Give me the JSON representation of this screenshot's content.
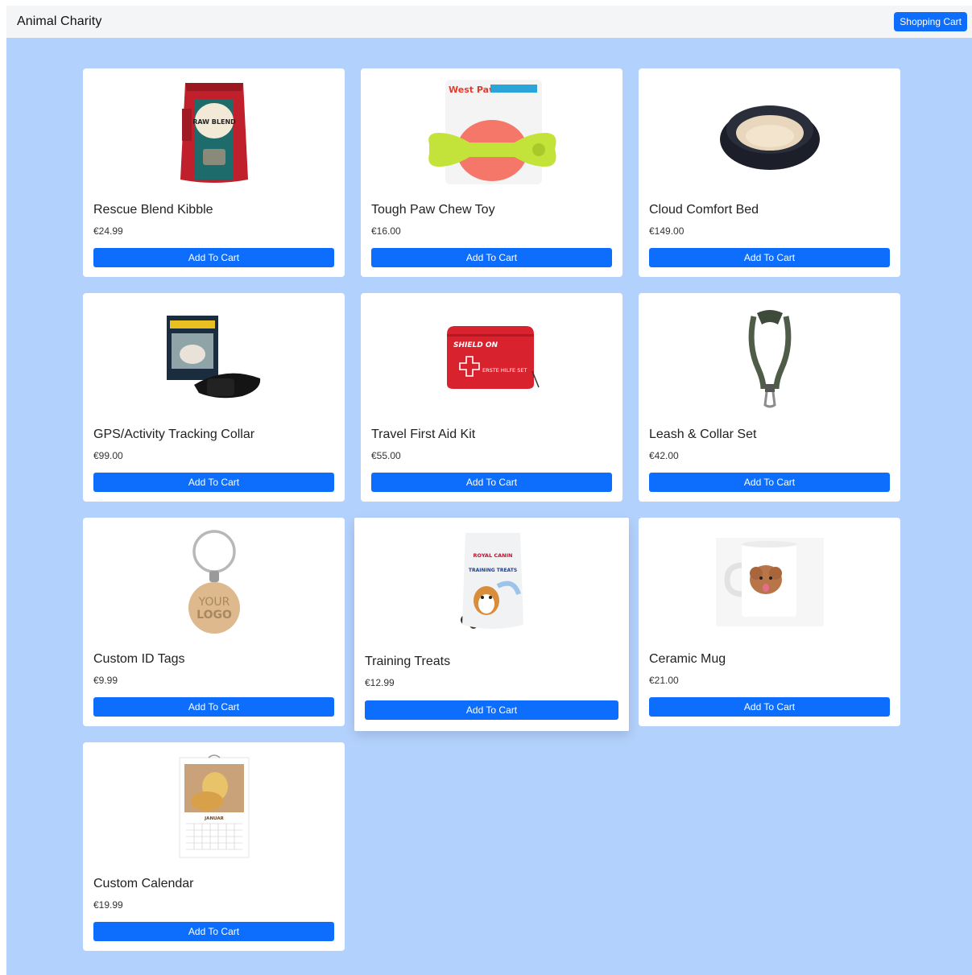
{
  "navbar": {
    "brand": "Animal Charity",
    "cart_label": "Shopping Cart"
  },
  "colors": {
    "accent": "#0d6efd",
    "background": "#b3d1fd",
    "card": "#ffffff"
  },
  "products": [
    {
      "name": "Rescue Blend Kibble",
      "price": "€24.99",
      "button": "Add To Cart",
      "image_icon": "kibble-bag-icon"
    },
    {
      "name": "Tough Paw Chew Toy",
      "price": "€16.00",
      "button": "Add To Cart",
      "image_icon": "chew-toy-icon"
    },
    {
      "name": "Cloud Comfort Bed",
      "price": "€149.00",
      "button": "Add To Cart",
      "image_icon": "pet-bed-icon"
    },
    {
      "name": "GPS/Activity Tracking Collar",
      "price": "€99.00",
      "button": "Add To Cart",
      "image_icon": "gps-collar-icon"
    },
    {
      "name": "Travel First Aid Kit",
      "price": "€55.00",
      "button": "Add To Cart",
      "image_icon": "first-aid-kit-icon"
    },
    {
      "name": "Leash & Collar Set",
      "price": "€42.00",
      "button": "Add To Cart",
      "image_icon": "leash-icon"
    },
    {
      "name": "Custom ID Tags",
      "price": "€9.99",
      "button": "Add To Cart",
      "image_icon": "id-tag-icon"
    },
    {
      "name": "Training Treats",
      "price": "€12.99",
      "button": "Add To Cart",
      "image_icon": "treats-bag-icon"
    },
    {
      "name": "Ceramic Mug",
      "price": "€21.00",
      "button": "Add To Cart",
      "image_icon": "mug-icon"
    },
    {
      "name": "Custom Calendar",
      "price": "€19.99",
      "button": "Add To Cart",
      "image_icon": "calendar-icon"
    }
  ],
  "image_text": {
    "kibble": "RAW BLEND",
    "chew_brand": "West Paw",
    "first_aid_brand": "SHIELD ON",
    "first_aid_sub": "ERSTE HILFE SET",
    "tag_logo_1": "YOUR",
    "tag_logo_2": "LOGO",
    "treats_brand": "ROYAL CANIN",
    "treats_label": "TRAINING TREATS",
    "calendar_month": "JANUAR"
  }
}
